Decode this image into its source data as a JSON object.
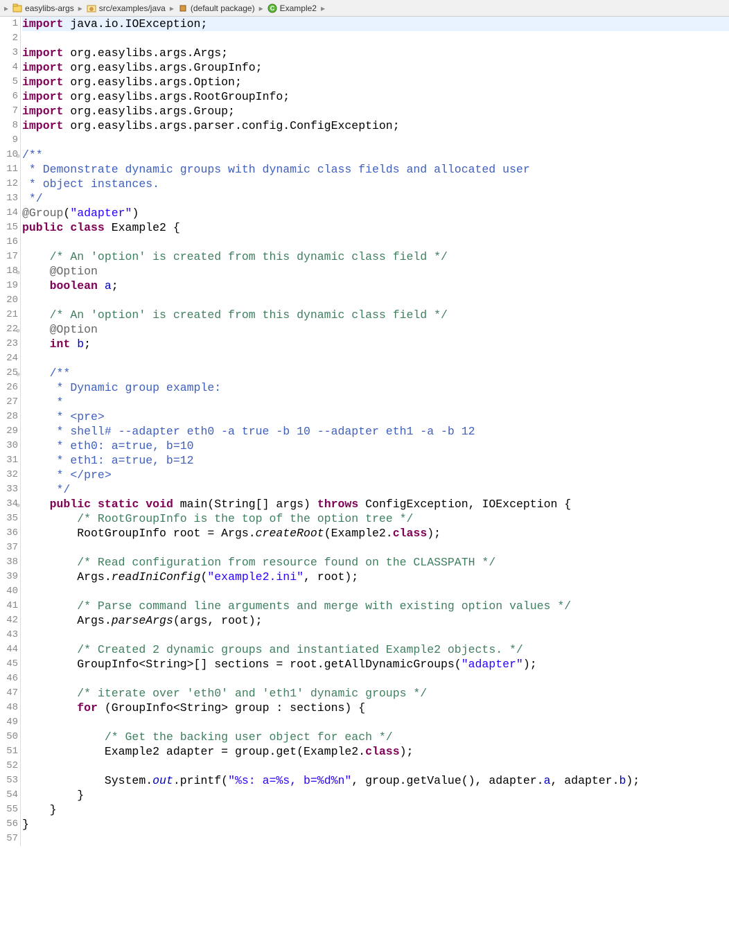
{
  "breadcrumb": {
    "items": [
      {
        "label": "easylibs-args",
        "icon": "project"
      },
      {
        "label": "src/examples/java",
        "icon": "package-folder"
      },
      {
        "label": "(default package)",
        "icon": "package"
      },
      {
        "label": "Example2",
        "icon": "class"
      }
    ]
  },
  "lines": [
    {
      "n": "1",
      "fold": "",
      "highlight": true,
      "segs": [
        {
          "c": "kw",
          "t": "import"
        },
        {
          "c": "",
          "t": " java.io.IOException;"
        }
      ]
    },
    {
      "n": "2",
      "fold": "",
      "segs": [
        {
          "c": "",
          "t": ""
        }
      ]
    },
    {
      "n": "3",
      "fold": "",
      "segs": [
        {
          "c": "kw",
          "t": "import"
        },
        {
          "c": "",
          "t": " org.easylibs.args.Args;"
        }
      ]
    },
    {
      "n": "4",
      "fold": "",
      "segs": [
        {
          "c": "kw",
          "t": "import"
        },
        {
          "c": "",
          "t": " org.easylibs.args.GroupInfo;"
        }
      ]
    },
    {
      "n": "5",
      "fold": "",
      "segs": [
        {
          "c": "kw",
          "t": "import"
        },
        {
          "c": "",
          "t": " org.easylibs.args.Option;"
        }
      ]
    },
    {
      "n": "6",
      "fold": "",
      "segs": [
        {
          "c": "kw",
          "t": "import"
        },
        {
          "c": "",
          "t": " org.easylibs.args.RootGroupInfo;"
        }
      ]
    },
    {
      "n": "7",
      "fold": "",
      "segs": [
        {
          "c": "kw",
          "t": "import"
        },
        {
          "c": "",
          "t": " org.easylibs.args.Group;"
        }
      ]
    },
    {
      "n": "8",
      "fold": "",
      "segs": [
        {
          "c": "kw",
          "t": "import"
        },
        {
          "c": "",
          "t": " org.easylibs.args.parser.config.ConfigException;"
        }
      ]
    },
    {
      "n": "9",
      "fold": "",
      "segs": [
        {
          "c": "",
          "t": ""
        }
      ]
    },
    {
      "n": "10",
      "fold": "⊖",
      "segs": [
        {
          "c": "doc",
          "t": "/**"
        }
      ]
    },
    {
      "n": "11",
      "fold": "",
      "segs": [
        {
          "c": "doc",
          "t": " * Demonstrate dynamic groups with dynamic class fields and allocated user"
        }
      ]
    },
    {
      "n": "12",
      "fold": "",
      "segs": [
        {
          "c": "doc",
          "t": " * object instances."
        }
      ]
    },
    {
      "n": "13",
      "fold": "",
      "segs": [
        {
          "c": "doc",
          "t": " */"
        }
      ]
    },
    {
      "n": "14",
      "fold": "",
      "segs": [
        {
          "c": "ann",
          "t": "@Group"
        },
        {
          "c": "",
          "t": "("
        },
        {
          "c": "str",
          "t": "\"adapter\""
        },
        {
          "c": "",
          "t": ")"
        }
      ]
    },
    {
      "n": "15",
      "fold": "",
      "segs": [
        {
          "c": "kw",
          "t": "public"
        },
        {
          "c": "",
          "t": " "
        },
        {
          "c": "kw",
          "t": "class"
        },
        {
          "c": "",
          "t": " Example2 {"
        }
      ]
    },
    {
      "n": "16",
      "fold": "",
      "segs": [
        {
          "c": "",
          "t": ""
        }
      ]
    },
    {
      "n": "17",
      "fold": "",
      "segs": [
        {
          "c": "",
          "t": "    "
        },
        {
          "c": "comment",
          "t": "/* An 'option' is created from this dynamic class field */"
        }
      ]
    },
    {
      "n": "18",
      "fold": "⊖",
      "segs": [
        {
          "c": "",
          "t": "    "
        },
        {
          "c": "ann",
          "t": "@Option"
        }
      ]
    },
    {
      "n": "19",
      "fold": "",
      "segs": [
        {
          "c": "",
          "t": "    "
        },
        {
          "c": "kw",
          "t": "boolean"
        },
        {
          "c": "",
          "t": " "
        },
        {
          "c": "field",
          "t": "a"
        },
        {
          "c": "",
          "t": ";"
        }
      ]
    },
    {
      "n": "20",
      "fold": "",
      "segs": [
        {
          "c": "",
          "t": ""
        }
      ]
    },
    {
      "n": "21",
      "fold": "",
      "segs": [
        {
          "c": "",
          "t": "    "
        },
        {
          "c": "comment",
          "t": "/* An 'option' is created from this dynamic class field */"
        }
      ]
    },
    {
      "n": "22",
      "fold": "⊖",
      "segs": [
        {
          "c": "",
          "t": "    "
        },
        {
          "c": "ann",
          "t": "@Option"
        }
      ]
    },
    {
      "n": "23",
      "fold": "",
      "segs": [
        {
          "c": "",
          "t": "    "
        },
        {
          "c": "kw",
          "t": "int"
        },
        {
          "c": "",
          "t": " "
        },
        {
          "c": "field",
          "t": "b"
        },
        {
          "c": "",
          "t": ";"
        }
      ]
    },
    {
      "n": "24",
      "fold": "",
      "segs": [
        {
          "c": "",
          "t": ""
        }
      ]
    },
    {
      "n": "25",
      "fold": "⊖",
      "segs": [
        {
          "c": "",
          "t": "    "
        },
        {
          "c": "doc",
          "t": "/**"
        }
      ]
    },
    {
      "n": "26",
      "fold": "",
      "segs": [
        {
          "c": "",
          "t": "    "
        },
        {
          "c": "doc",
          "t": " * Dynamic group example:"
        }
      ]
    },
    {
      "n": "27",
      "fold": "",
      "segs": [
        {
          "c": "",
          "t": "    "
        },
        {
          "c": "doc",
          "t": " * "
        }
      ]
    },
    {
      "n": "28",
      "fold": "",
      "segs": [
        {
          "c": "",
          "t": "    "
        },
        {
          "c": "doc",
          "t": " * <pre>"
        }
      ]
    },
    {
      "n": "29",
      "fold": "",
      "segs": [
        {
          "c": "",
          "t": "    "
        },
        {
          "c": "doc",
          "t": " * shell# --adapter eth0 -a true -b 10 --adapter eth1 -a -b 12"
        }
      ]
    },
    {
      "n": "30",
      "fold": "",
      "segs": [
        {
          "c": "",
          "t": "    "
        },
        {
          "c": "doc",
          "t": " * eth0: a=true, b=10"
        }
      ]
    },
    {
      "n": "31",
      "fold": "",
      "segs": [
        {
          "c": "",
          "t": "    "
        },
        {
          "c": "doc",
          "t": " * eth1: a=true, b=12"
        }
      ]
    },
    {
      "n": "32",
      "fold": "",
      "segs": [
        {
          "c": "",
          "t": "    "
        },
        {
          "c": "doc",
          "t": " * </pre>"
        }
      ]
    },
    {
      "n": "33",
      "fold": "",
      "segs": [
        {
          "c": "",
          "t": "    "
        },
        {
          "c": "doc",
          "t": " */"
        }
      ]
    },
    {
      "n": "34",
      "fold": "⊖",
      "segs": [
        {
          "c": "",
          "t": "    "
        },
        {
          "c": "kw",
          "t": "public"
        },
        {
          "c": "",
          "t": " "
        },
        {
          "c": "kw",
          "t": "static"
        },
        {
          "c": "",
          "t": " "
        },
        {
          "c": "kw",
          "t": "void"
        },
        {
          "c": "",
          "t": " main(String[] args) "
        },
        {
          "c": "kw",
          "t": "throws"
        },
        {
          "c": "",
          "t": " ConfigException, IOException {"
        }
      ]
    },
    {
      "n": "35",
      "fold": "",
      "segs": [
        {
          "c": "",
          "t": "        "
        },
        {
          "c": "comment",
          "t": "/* RootGroupInfo is the top of the option tree */"
        }
      ]
    },
    {
      "n": "36",
      "fold": "",
      "segs": [
        {
          "c": "",
          "t": "        RootGroupInfo root = Args."
        },
        {
          "c": "static-call",
          "t": "createRoot"
        },
        {
          "c": "",
          "t": "(Example2."
        },
        {
          "c": "kw",
          "t": "class"
        },
        {
          "c": "",
          "t": ");"
        }
      ]
    },
    {
      "n": "37",
      "fold": "",
      "segs": [
        {
          "c": "",
          "t": ""
        }
      ]
    },
    {
      "n": "38",
      "fold": "",
      "segs": [
        {
          "c": "",
          "t": "        "
        },
        {
          "c": "comment",
          "t": "/* Read configuration from resource found on the CLASSPATH */"
        }
      ]
    },
    {
      "n": "39",
      "fold": "",
      "segs": [
        {
          "c": "",
          "t": "        Args."
        },
        {
          "c": "static-call",
          "t": "readIniConfig"
        },
        {
          "c": "",
          "t": "("
        },
        {
          "c": "str",
          "t": "\"example2.ini\""
        },
        {
          "c": "",
          "t": ", root);"
        }
      ]
    },
    {
      "n": "40",
      "fold": "",
      "segs": [
        {
          "c": "",
          "t": ""
        }
      ]
    },
    {
      "n": "41",
      "fold": "",
      "segs": [
        {
          "c": "",
          "t": "        "
        },
        {
          "c": "comment",
          "t": "/* Parse command line arguments and merge with existing option values */"
        }
      ]
    },
    {
      "n": "42",
      "fold": "",
      "segs": [
        {
          "c": "",
          "t": "        Args."
        },
        {
          "c": "static-call",
          "t": "parseArgs"
        },
        {
          "c": "",
          "t": "(args, root);"
        }
      ]
    },
    {
      "n": "43",
      "fold": "",
      "segs": [
        {
          "c": "",
          "t": ""
        }
      ]
    },
    {
      "n": "44",
      "fold": "",
      "segs": [
        {
          "c": "",
          "t": "        "
        },
        {
          "c": "comment",
          "t": "/* Created 2 dynamic groups and instantiated Example2 objects. */"
        }
      ]
    },
    {
      "n": "45",
      "fold": "",
      "segs": [
        {
          "c": "",
          "t": "        GroupInfo<String>[] sections = root.getAllDynamicGroups("
        },
        {
          "c": "str",
          "t": "\"adapter\""
        },
        {
          "c": "",
          "t": ");"
        }
      ]
    },
    {
      "n": "46",
      "fold": "",
      "segs": [
        {
          "c": "",
          "t": ""
        }
      ]
    },
    {
      "n": "47",
      "fold": "",
      "segs": [
        {
          "c": "",
          "t": "        "
        },
        {
          "c": "comment",
          "t": "/* iterate over 'eth0' and 'eth1' dynamic groups */"
        }
      ]
    },
    {
      "n": "48",
      "fold": "",
      "segs": [
        {
          "c": "",
          "t": "        "
        },
        {
          "c": "kw",
          "t": "for"
        },
        {
          "c": "",
          "t": " (GroupInfo<String> group : sections) {"
        }
      ]
    },
    {
      "n": "49",
      "fold": "",
      "segs": [
        {
          "c": "",
          "t": ""
        }
      ]
    },
    {
      "n": "50",
      "fold": "",
      "segs": [
        {
          "c": "",
          "t": "            "
        },
        {
          "c": "comment",
          "t": "/* Get the backing user object for each */"
        }
      ]
    },
    {
      "n": "51",
      "fold": "",
      "segs": [
        {
          "c": "",
          "t": "            Example2 adapter = group.get(Example2."
        },
        {
          "c": "kw",
          "t": "class"
        },
        {
          "c": "",
          "t": ");"
        }
      ]
    },
    {
      "n": "52",
      "fold": "",
      "segs": [
        {
          "c": "",
          "t": ""
        }
      ]
    },
    {
      "n": "53",
      "fold": "",
      "segs": [
        {
          "c": "",
          "t": "            System."
        },
        {
          "c": "static-field",
          "t": "out"
        },
        {
          "c": "",
          "t": ".printf("
        },
        {
          "c": "str",
          "t": "\"%s: a=%s, b=%d%n\""
        },
        {
          "c": "",
          "t": ", group.getValue(), adapter."
        },
        {
          "c": "field",
          "t": "a"
        },
        {
          "c": "",
          "t": ", adapter."
        },
        {
          "c": "field",
          "t": "b"
        },
        {
          "c": "",
          "t": ");"
        }
      ]
    },
    {
      "n": "54",
      "fold": "",
      "segs": [
        {
          "c": "",
          "t": "        }"
        }
      ]
    },
    {
      "n": "55",
      "fold": "",
      "segs": [
        {
          "c": "",
          "t": "    }"
        }
      ]
    },
    {
      "n": "56",
      "fold": "",
      "segs": [
        {
          "c": "",
          "t": "}"
        }
      ]
    },
    {
      "n": "57",
      "fold": "",
      "segs": [
        {
          "c": "",
          "t": ""
        }
      ]
    }
  ]
}
